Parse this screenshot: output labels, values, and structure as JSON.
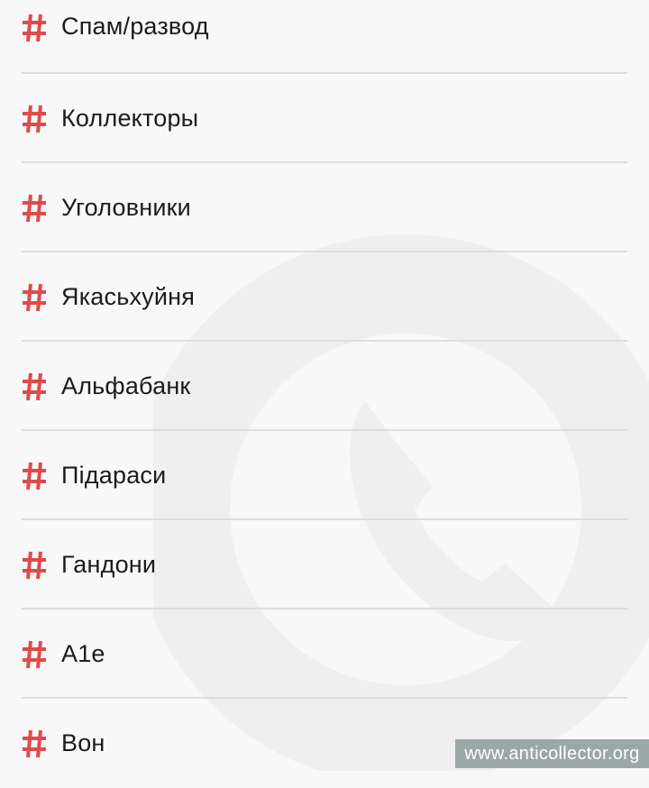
{
  "colors": {
    "hash_accent": "#e04a4a",
    "text": "#1b1b1b",
    "divider": "#dddddd",
    "background": "#f8f8f8"
  },
  "tags": [
    {
      "icon": "hash-icon",
      "label": "Спам/развод"
    },
    {
      "icon": "hash-icon",
      "label": "Коллекторы"
    },
    {
      "icon": "hash-icon",
      "label": "Уголовники"
    },
    {
      "icon": "hash-icon",
      "label": "Якасьхуйня"
    },
    {
      "icon": "hash-icon",
      "label": "Альфабанк"
    },
    {
      "icon": "hash-icon",
      "label": "Підараси"
    },
    {
      "icon": "hash-icon",
      "label": "Гандони"
    },
    {
      "icon": "hash-icon",
      "label": "А1е"
    },
    {
      "icon": "hash-icon",
      "label": "Вон"
    }
  ],
  "watermark": {
    "text": "www.anticollector.org",
    "icon": "phone-icon"
  }
}
